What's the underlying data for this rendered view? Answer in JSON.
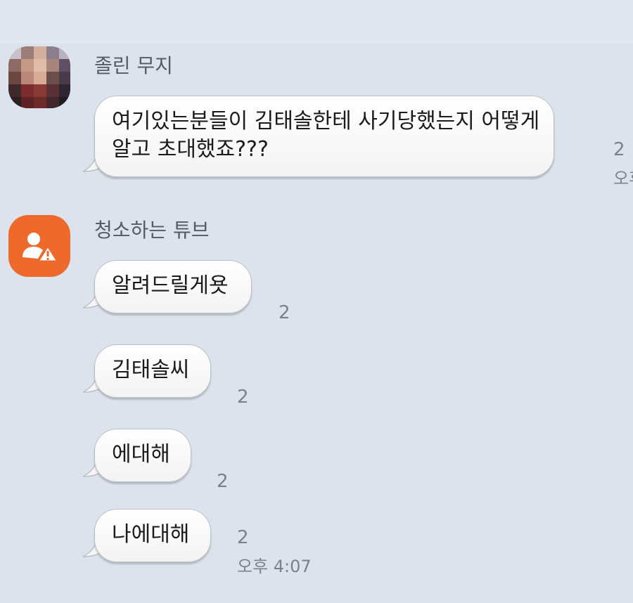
{
  "messages": [
    {
      "sender": "졸린 무지",
      "avatar_icon": "pixelated-profile-photo",
      "bubbles": [
        {
          "lines": [
            "여기있는분들이 김태솔한테 사기당했는지 어떻게",
            "알고 초대했죠???"
          ],
          "unread": "2",
          "time": "오후"
        }
      ]
    },
    {
      "sender": "청소하는 튜브",
      "avatar_icon": "user-warning-icon",
      "bubbles": [
        {
          "lines": [
            "알려드릴게욧"
          ],
          "unread": "2"
        },
        {
          "lines": [
            "김태솔씨"
          ],
          "unread": "2"
        },
        {
          "lines": [
            "에대해"
          ],
          "unread": "2"
        },
        {
          "lines": [
            "나에대해"
          ],
          "unread": "2",
          "time": "오후 4:07"
        }
      ]
    }
  ],
  "colors": {
    "background": "#dde3ec",
    "avatar_orange": "#ee6a2c",
    "bubble": "#ffffff",
    "meta_text": "#7d828a"
  }
}
